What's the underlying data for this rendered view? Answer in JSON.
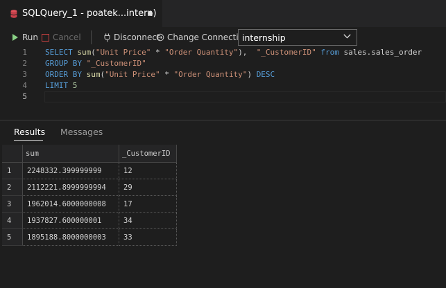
{
  "tab": {
    "title": "SQLQuery_1 - poatek...intern)",
    "icon": "database-icon",
    "icon_color": "#e0505a"
  },
  "toolbar": {
    "run_label": "Run",
    "cancel_label": "Cancel",
    "disconnect_label": "Disconnect",
    "change_connection_label": "Change Connection",
    "database_selected": "internship"
  },
  "editor": {
    "line_numbers": [
      "1",
      "2",
      "3",
      "4",
      "5"
    ],
    "lines": [
      [
        {
          "t": "SELECT ",
          "c": "kw"
        },
        {
          "t": "sum",
          "c": "fn"
        },
        {
          "t": "(",
          "c": "id"
        },
        {
          "t": "\"Unit Price\"",
          "c": "str"
        },
        {
          "t": " * ",
          "c": "id"
        },
        {
          "t": "\"Order Quantity\"",
          "c": "str"
        },
        {
          "t": "),  ",
          "c": "id"
        },
        {
          "t": "\"_CustomerID\"",
          "c": "str"
        },
        {
          "t": " from ",
          "c": "kw"
        },
        {
          "t": "sales.sales_order",
          "c": "id"
        }
      ],
      [
        {
          "t": "GROUP BY ",
          "c": "kw"
        },
        {
          "t": "\"_CustomerID\"",
          "c": "str"
        }
      ],
      [
        {
          "t": "ORDER BY ",
          "c": "kw"
        },
        {
          "t": "sum",
          "c": "fn"
        },
        {
          "t": "(",
          "c": "id"
        },
        {
          "t": "\"Unit Price\"",
          "c": "str"
        },
        {
          "t": " * ",
          "c": "id"
        },
        {
          "t": "\"Order Quantity\"",
          "c": "str"
        },
        {
          "t": ") ",
          "c": "id"
        },
        {
          "t": "DESC",
          "c": "kw"
        }
      ],
      [
        {
          "t": "LIMIT ",
          "c": "kw"
        },
        {
          "t": "5",
          "c": "num"
        }
      ],
      []
    ]
  },
  "results": {
    "tabs": [
      "Results",
      "Messages"
    ],
    "columns": [
      "sum",
      "_CustomerID"
    ],
    "rows": [
      [
        "1",
        "2248332.399999999",
        "12"
      ],
      [
        "2",
        "2112221.8999999994",
        "29"
      ],
      [
        "3",
        "1962014.6000000008",
        "17"
      ],
      [
        "4",
        "1937827.600000001",
        "34"
      ],
      [
        "5",
        "1895188.8000000003",
        "33"
      ]
    ]
  }
}
